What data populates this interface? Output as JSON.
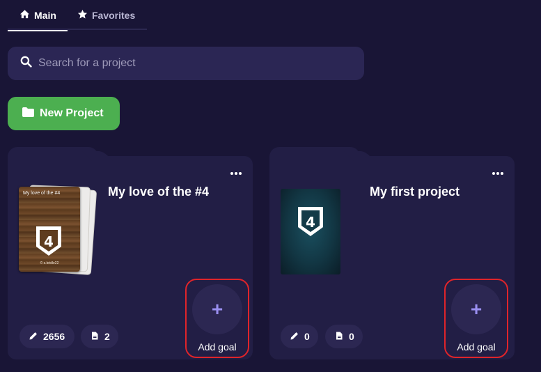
{
  "tabs": [
    {
      "label": "Main",
      "icon": "home-icon",
      "active": true
    },
    {
      "label": "Favorites",
      "icon": "star-icon",
      "active": false
    }
  ],
  "search": {
    "placeholder": "Search for a project",
    "value": ""
  },
  "new_project": {
    "label": "New Project",
    "icon": "folder-icon"
  },
  "projects": [
    {
      "title": "My love of the #4",
      "cover": {
        "text": "My love of the #4",
        "author": "© s.bridle22",
        "emblem": "4"
      },
      "words": "2656",
      "docs": "2",
      "add_goal_label": "Add goal"
    },
    {
      "title": "My first project",
      "cover": {
        "emblem": "4"
      },
      "words": "0",
      "docs": "0",
      "add_goal_label": "Add goal"
    }
  ],
  "colors": {
    "background": "#191536",
    "card": "#221e45",
    "accent_green": "#4caf50",
    "highlight_red": "#e0242a",
    "plus": "#9a8ff0"
  }
}
